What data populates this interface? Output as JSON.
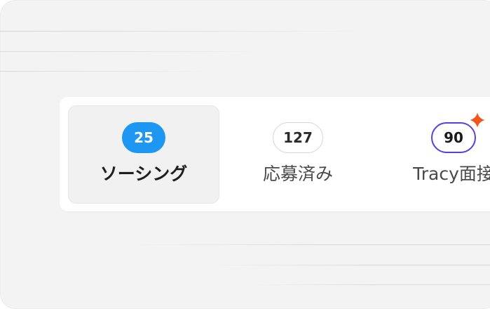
{
  "tabs": [
    {
      "count": "25",
      "label": "ソーシング",
      "selected": true
    },
    {
      "count": "127",
      "label": "応募済み",
      "selected": false
    },
    {
      "count": "90",
      "label": "Tracy面接",
      "selected": false
    }
  ],
  "icons": {
    "ai_badge": "sparkle-icon"
  },
  "colors": {
    "selected_badge": "#1e97f3",
    "ai_outline": "#5a3fdc",
    "sparkle": "#f2561d"
  }
}
